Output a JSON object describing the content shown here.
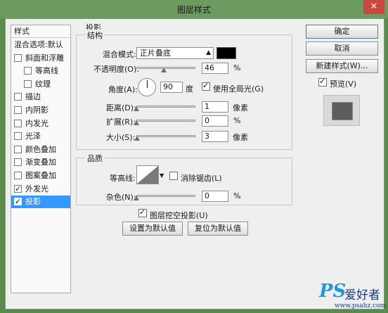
{
  "window": {
    "title": "图层样式",
    "close_label": "✕"
  },
  "sidebar": {
    "header": "样式",
    "items": [
      {
        "label": "混合选项:默认",
        "checkbox": false,
        "checked": false,
        "active": false
      },
      {
        "label": "斜面和浮雕",
        "checkbox": true,
        "checked": false,
        "active": false
      },
      {
        "label": "等高线",
        "checkbox": true,
        "checked": false,
        "active": false,
        "indent": true
      },
      {
        "label": "纹理",
        "checkbox": true,
        "checked": false,
        "active": false,
        "indent": true
      },
      {
        "label": "描边",
        "checkbox": true,
        "checked": false,
        "active": false
      },
      {
        "label": "内阴影",
        "checkbox": true,
        "checked": false,
        "active": false
      },
      {
        "label": "内发光",
        "checkbox": true,
        "checked": false,
        "active": false
      },
      {
        "label": "光泽",
        "checkbox": true,
        "checked": false,
        "active": false
      },
      {
        "label": "颜色叠加",
        "checkbox": true,
        "checked": false,
        "active": false
      },
      {
        "label": "渐变叠加",
        "checkbox": true,
        "checked": false,
        "active": false
      },
      {
        "label": "图案叠加",
        "checkbox": true,
        "checked": false,
        "active": false
      },
      {
        "label": "外发光",
        "checkbox": true,
        "checked": true,
        "active": false
      },
      {
        "label": "投影",
        "checkbox": true,
        "checked": true,
        "active": true
      }
    ]
  },
  "shadow": {
    "title": "投影",
    "structure": {
      "title": "结构",
      "blend_mode_label": "混合模式:",
      "blend_mode_value": "正片叠底",
      "color": "#000000",
      "opacity_label": "不透明度(O):",
      "opacity_value": "46",
      "opacity_unit": "%",
      "opacity_fraction": 0.46,
      "angle_label": "角度(A):",
      "angle_value": "90",
      "angle_unit": "度",
      "global_light_label": "使用全局光(G)",
      "global_light_checked": true,
      "distance_label": "距离(D):",
      "distance_value": "1",
      "distance_unit": "像素",
      "distance_fraction": 0.0,
      "spread_label": "扩展(R):",
      "spread_value": "0",
      "spread_unit": "%",
      "spread_fraction": 0.0,
      "size_label": "大小(S):",
      "size_value": "3",
      "size_unit": "像素",
      "size_fraction": 0.01
    },
    "quality": {
      "title": "品质",
      "contour_label": "等高线:",
      "antialias_label": "消除锯齿(L)",
      "antialias_checked": false,
      "noise_label": "杂色(N):",
      "noise_value": "0",
      "noise_unit": "%",
      "noise_fraction": 0.0
    },
    "knockout_label": "图层挖空投影(U)",
    "knockout_checked": true,
    "make_default_label": "设置为默认值",
    "reset_default_label": "复位为默认值"
  },
  "actions": {
    "ok_label": "确定",
    "cancel_label": "取消",
    "new_style_label": "新建样式(W)...",
    "preview_label": "预览(V)",
    "preview_checked": true
  },
  "watermark": {
    "logo": "PS",
    "cn": "爱好者",
    "url": "www.psahz.com"
  },
  "colors": {
    "accent": "#3399ff",
    "title_bar": "#6d9b5f",
    "close": "#c9473e"
  }
}
